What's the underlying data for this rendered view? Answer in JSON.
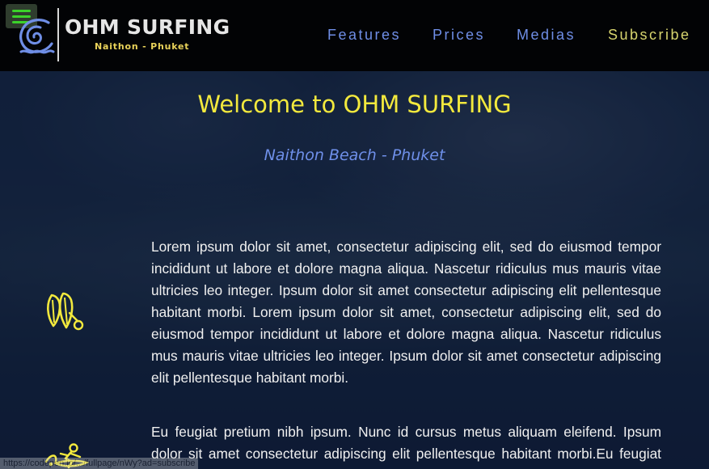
{
  "brand": {
    "title": "OHM SURFING",
    "subtitle": "Naithon - Phuket"
  },
  "nav": {
    "items": [
      {
        "label": "Features"
      },
      {
        "label": "Prices"
      },
      {
        "label": "Medias"
      },
      {
        "label": "Subscribe"
      }
    ]
  },
  "hero": {
    "title": "Welcome to OHM SURFING",
    "subtitle": "Naithon Beach - Phuket"
  },
  "features": [
    {
      "icon": "surfboards-icon",
      "text": "Lorem ipsum dolor sit amet, consectetur adipiscing elit, sed do eiusmod tempor incididunt ut labore et dolore magna aliqua. Nascetur ridiculus mus mauris vitae ultricies leo integer. Ipsum dolor sit amet consectetur adipiscing elit pellentesque habitant morbi. Lorem ipsum dolor sit amet, consectetur adipiscing elit, sed do eiusmod tempor incididunt ut labore et dolore magna aliqua. Nascetur ridiculus mus mauris vitae ultricies leo integer. Ipsum dolor sit amet consectetur adipiscing elit pellentesque habitant morbi."
    },
    {
      "icon": "surfer-icon",
      "text": "Eu feugiat pretium nibh ipsum. Nunc id cursus metus aliquam eleifend. Ipsum dolor sit amet consectetur adipiscing elit pellentesque habitant morbi.Eu feugiat pretium"
    }
  ],
  "status_bar": {
    "url": "https://codepen.io/.../fullpage/nWy?ad=subscribe"
  },
  "colors": {
    "accent_yellow": "#f3e93d",
    "accent_blue": "#6f8ee6",
    "nav_bg": "#020305",
    "hamburger_green": "#3bd22a"
  }
}
